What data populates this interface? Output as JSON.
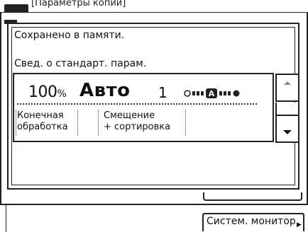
{
  "window": {
    "title": "[Параметры копий]"
  },
  "dialog": {
    "saved_message": "Сохранено в памяти.",
    "info_label": "Свед. о стандарт. парам."
  },
  "settings": {
    "zoom_value": "100",
    "zoom_unit": "%",
    "paper": "Авто",
    "copies": "1",
    "density_level_fraction": 0.5,
    "finishing_line1": "Конечная",
    "finishing_line2": "обработка",
    "shift_line1": "Смещение",
    "shift_line2": "+ сортировка"
  },
  "scroll": {
    "up_icon": "triangle-up-icon",
    "down_icon": "triangle-down-icon"
  },
  "status_bar": {
    "system_monitor_label": "Систем. монитор",
    "arrow_icon": "triangle-right-small-icon"
  }
}
